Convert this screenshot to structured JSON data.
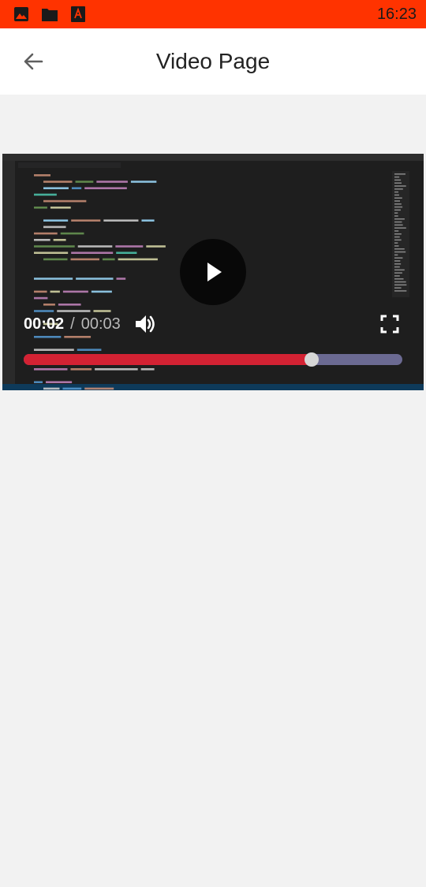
{
  "status_bar": {
    "time": "16:23",
    "icons": [
      "image-icon",
      "folder-icon",
      "pdf-icon"
    ]
  },
  "app_bar": {
    "title": "Video Page",
    "back_icon": "arrow-back-icon"
  },
  "player": {
    "current_time": "00:02",
    "separator": "/",
    "total_time": "00:03",
    "progress": 0.76,
    "play_icon": "play-icon",
    "volume_icon": "volume-up-icon",
    "fullscreen_icon": "fullscreen-icon"
  },
  "colors": {
    "status_bar": "#ff3300",
    "progress_played": "#d32233",
    "progress_track": "#6b6a92"
  }
}
